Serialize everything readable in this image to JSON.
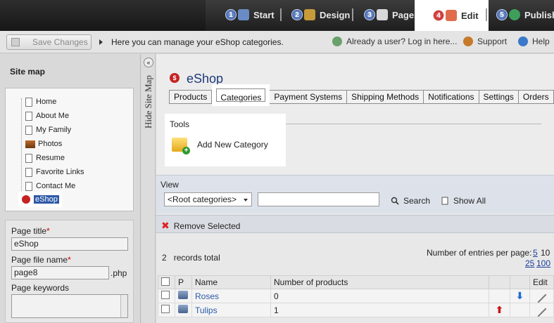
{
  "wizard": {
    "steps": [
      {
        "num": "1",
        "label": "Start"
      },
      {
        "num": "2",
        "label": "Design"
      },
      {
        "num": "3",
        "label": "Pages"
      },
      {
        "num": "4",
        "label": "Edit"
      },
      {
        "num": "5",
        "label": "Publish"
      }
    ],
    "active_step": "Edit"
  },
  "toolbar": {
    "save_label": "Save Changes",
    "hint": "Here you can manage your eShop categories.",
    "login_link": "Already a user? Log in here...",
    "support_link": "Support",
    "help_link": "Help"
  },
  "sitemap": {
    "title": "Site map",
    "items": [
      "Home",
      "About Me",
      "My Family",
      "Photos",
      "Resume",
      "Favorite Links",
      "Contact Me",
      "eShop"
    ],
    "selected": "eShop",
    "hide_label": "Hide Site Map"
  },
  "page_props": {
    "title_label": "Page title",
    "title_value": "eShop",
    "file_label": "Page file name",
    "file_value": "page8",
    "file_ext": ".php",
    "keywords_label": "Page keywords"
  },
  "main": {
    "title": "eShop",
    "tabs": [
      "Products",
      "Categories",
      "Payment Systems",
      "Shipping Methods",
      "Notifications",
      "Settings",
      "Orders"
    ],
    "active_tab": "Categories",
    "tools_title": "Tools",
    "add_category": "Add New Category"
  },
  "view": {
    "label": "View",
    "select_value": "<Root categories>",
    "search_label": "Search",
    "show_all_label": "Show All",
    "remove_label": "Remove Selected"
  },
  "listing": {
    "records_count": "2",
    "records_text": "records total",
    "per_page_label": "Number of entries per page:",
    "per_page_options": [
      "5",
      "10",
      "25",
      "100"
    ],
    "columns": [
      "P",
      "Name",
      "Number of products",
      "Edit"
    ],
    "rows": [
      {
        "name": "Roses",
        "products": "0"
      },
      {
        "name": "Tulips",
        "products": "1"
      }
    ]
  }
}
